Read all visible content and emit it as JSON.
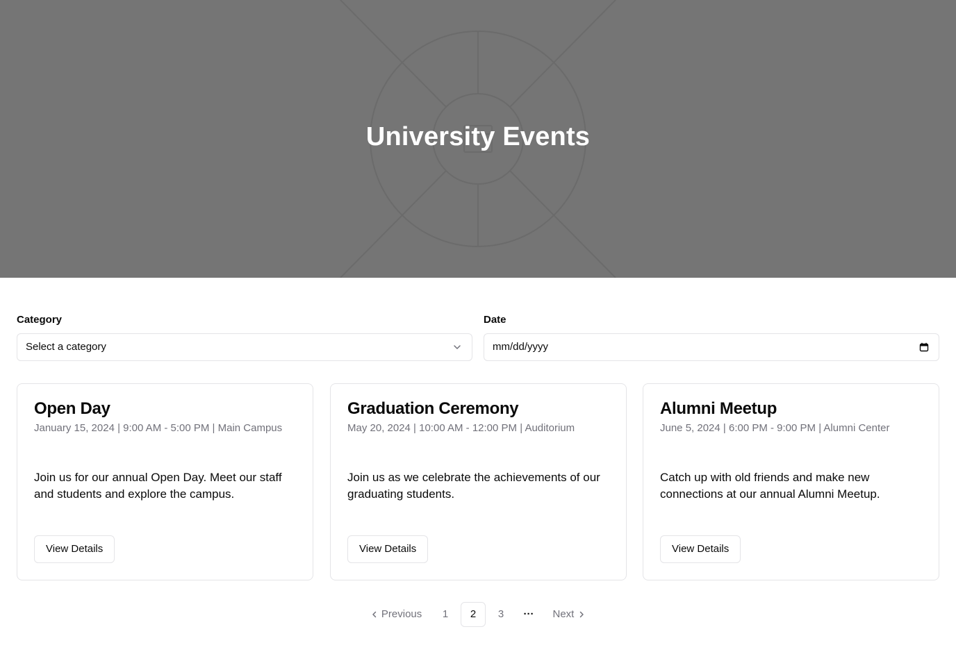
{
  "hero": {
    "title": "University Events",
    "background_color": "#757575",
    "decoration_icon": "building-logo-icon"
  },
  "filters": {
    "category": {
      "label": "Category",
      "placeholder": "Select a category",
      "icon": "chevron-down-icon"
    },
    "date": {
      "label": "Date",
      "placeholder": "mm/dd/yyyy",
      "icon": "calendar-icon"
    }
  },
  "events": [
    {
      "title": "Open Day",
      "meta": "January 15, 2024 | 9:00 AM - 5:00 PM | Main Campus",
      "description": "Join us for our annual Open Day. Meet our staff and students and explore the campus.",
      "button_label": "View Details"
    },
    {
      "title": "Graduation Ceremony",
      "meta": "May 20, 2024 | 10:00 AM - 12:00 PM | Auditorium",
      "description": "Join us as we celebrate the achievements of our graduating students.",
      "button_label": "View Details"
    },
    {
      "title": "Alumni Meetup",
      "meta": "June 5, 2024 | 6:00 PM - 9:00 PM | Alumni Center",
      "description": "Catch up with old friends and make new connections at our annual Alumni Meetup.",
      "button_label": "View Details"
    }
  ],
  "pagination": {
    "previous_label": "Previous",
    "next_label": "Next",
    "pages": [
      "1",
      "2",
      "3"
    ],
    "current_page": "2",
    "ellipsis": "···"
  },
  "colors": {
    "border": "#e4e4e7",
    "muted_text": "#71717a",
    "text": "#0a0a0a"
  }
}
